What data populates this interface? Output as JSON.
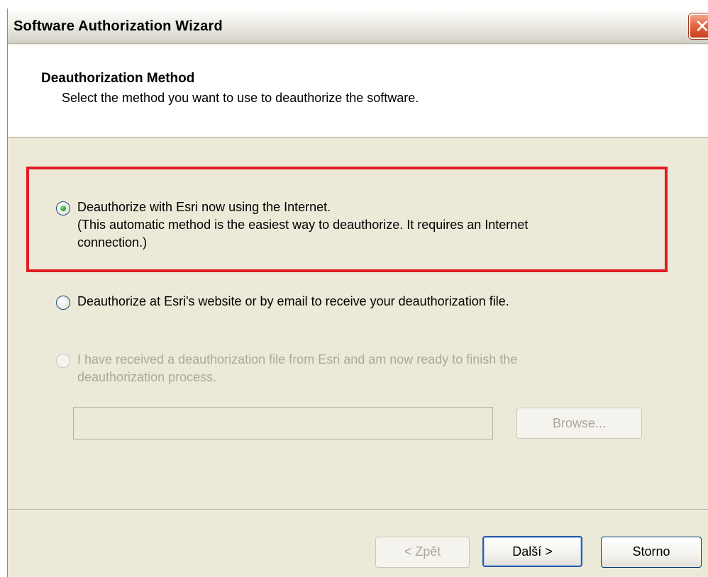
{
  "window": {
    "title": "Software Authorization Wizard"
  },
  "header": {
    "title": "Deauthorization Method",
    "subtitle": "Select the method you want to use to deauthorize the software."
  },
  "options": [
    {
      "label": "Deauthorize with Esri now using the Internet.",
      "detail_line1": "(This automatic method is the easiest way to deauthorize. It requires an Internet",
      "detail_line2": "connection.)",
      "selected": true,
      "enabled": true
    },
    {
      "label": "Deauthorize at Esri's website or by email to receive your deauthorization file.",
      "selected": false,
      "enabled": true
    },
    {
      "label_line1": "I have received a deauthorization file from Esri and am now ready to finish the",
      "label_line2": "deauthorization process.",
      "selected": false,
      "enabled": false
    }
  ],
  "file": {
    "path_value": "",
    "browse_label": "Browse..."
  },
  "buttons": {
    "back": "< Zpět",
    "next": "Další >",
    "cancel": "Storno"
  },
  "colors": {
    "highlight": "#e31b23",
    "dialog_bg": "#ece9d8",
    "disabled_text": "#aca899"
  },
  "icons": {
    "close": "close-icon"
  }
}
